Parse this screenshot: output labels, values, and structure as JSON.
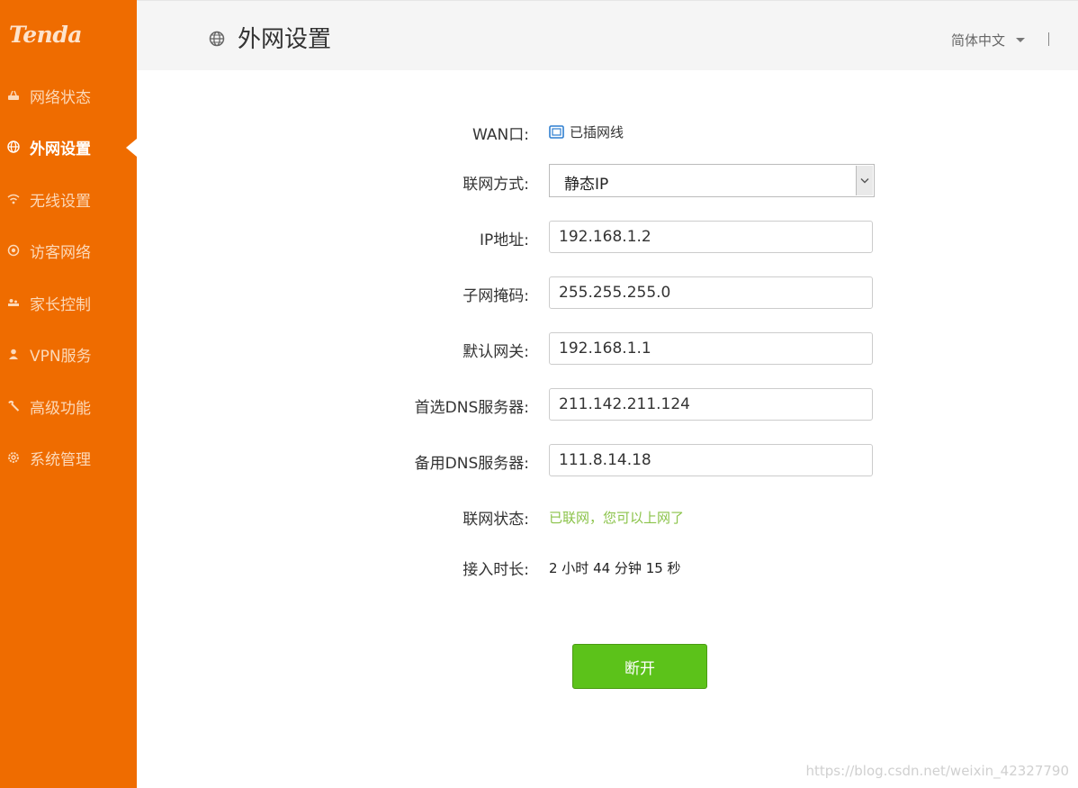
{
  "brand": {
    "logo": "Tenda",
    "accent_color": "#ef6c00"
  },
  "sidebar": {
    "items": [
      {
        "label": "网络状态",
        "icon": "router-icon",
        "active": false
      },
      {
        "label": "外网设置",
        "icon": "globe-icon",
        "active": true
      },
      {
        "label": "无线设置",
        "icon": "wifi-icon",
        "active": false
      },
      {
        "label": "访客网络",
        "icon": "guest-icon",
        "active": false
      },
      {
        "label": "家长控制",
        "icon": "parental-icon",
        "active": false
      },
      {
        "label": "VPN服务",
        "icon": "vpn-icon",
        "active": false
      },
      {
        "label": "高级功能",
        "icon": "wrench-icon",
        "active": false
      },
      {
        "label": "系统管理",
        "icon": "gear-icon",
        "active": false
      }
    ]
  },
  "header": {
    "title": "外网设置",
    "icon": "globe-icon",
    "language": "简体中文"
  },
  "form": {
    "wan_port": {
      "label": "WAN口:",
      "status": "已插网线"
    },
    "connection_type": {
      "label": "联网方式:",
      "value": "静态IP"
    },
    "ip_address": {
      "label": "IP地址:",
      "value": "192.168.1.2"
    },
    "subnet_mask": {
      "label": "子网掩码:",
      "value": "255.255.255.0"
    },
    "gateway": {
      "label": "默认网关:",
      "value": "192.168.1.1"
    },
    "primary_dns": {
      "label": "首选DNS服务器:",
      "value": "211.142.211.124"
    },
    "secondary_dns": {
      "label": "备用DNS服务器:",
      "value": "111.8.14.18"
    },
    "connection_status": {
      "label": "联网状态:",
      "value": "已联网，您可以上网了",
      "color": "#8bc34a"
    },
    "uptime": {
      "label": "接入时长:",
      "value": "2 小时 44 分钟 15 秒"
    }
  },
  "actions": {
    "disconnect_label": "断开",
    "button_color": "#5cc21a"
  },
  "watermark": "https://blog.csdn.net/weixin_42327790"
}
